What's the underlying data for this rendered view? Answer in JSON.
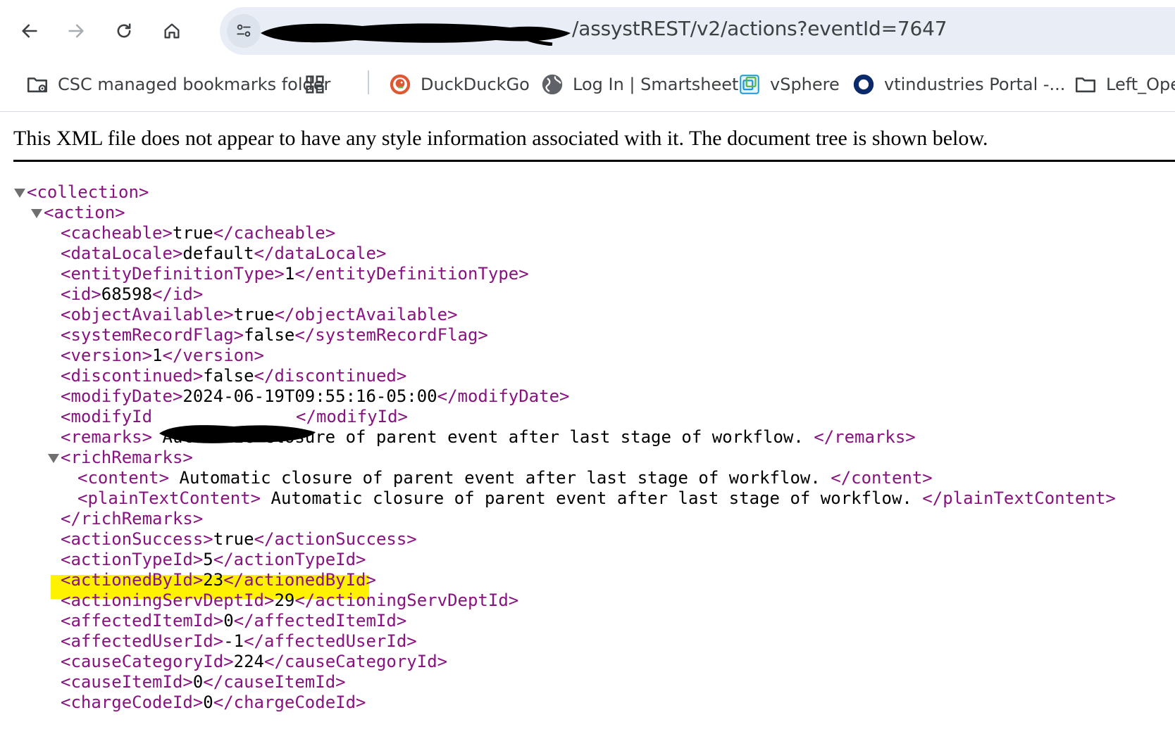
{
  "browser": {
    "url": "/assystREST/v2/actions?eventId=7647",
    "nav": [
      "back-icon",
      "forward-icon",
      "reload-icon",
      "home-icon"
    ]
  },
  "bookmarks": [
    {
      "label": "CSC managed bookmarks folder",
      "icon": "managed-folder-icon"
    },
    {
      "label": "DuckDuckGo",
      "icon": "duckduckgo-icon"
    },
    {
      "label": "Log In | Smartsheet",
      "icon": "globe-icon"
    },
    {
      "label": "vSphere",
      "icon": "vsphere-icon"
    },
    {
      "label": "vtindustries Portal -...",
      "icon": "portal-icon"
    },
    {
      "label": "Left_Ope",
      "icon": "folder-icon"
    }
  ],
  "xml": {
    "notice": "This XML file does not appear to have any style information associated with it. The document tree is shown below.",
    "lines": [
      {
        "open": "<collection>"
      },
      {
        "open": "<action>"
      },
      {
        "open": "<cacheable>",
        "text": "true",
        "close": "</cacheable>"
      },
      {
        "open": "<dataLocale>",
        "text": "default",
        "close": "</dataLocale>"
      },
      {
        "open": "<entityDefinitionType>",
        "text": "1",
        "close": "</entityDefinitionType>"
      },
      {
        "open": "<id>",
        "text": "68598",
        "close": "</id>"
      },
      {
        "open": "<objectAvailable>",
        "text": "true",
        "close": "</objectAvailable>"
      },
      {
        "open": "<systemRecordFlag>",
        "text": "false",
        "close": "</systemRecordFlag>"
      },
      {
        "open": "<version>",
        "text": "1",
        "close": "</version>"
      },
      {
        "open": "<discontinued>",
        "text": "false",
        "close": "</discontinued>"
      },
      {
        "open": "<modifyDate>",
        "text": "2024-06-19T09:55:16-05:00",
        "close": "</modifyDate>"
      },
      {
        "open": "<modifyId",
        "text": "",
        "close": "</modifyId>"
      },
      {
        "open": "<remarks>",
        "text": " Automatic closure of parent event after last stage of workflow. ",
        "close": "</remarks>"
      },
      {
        "open": "<richRemarks>"
      },
      {
        "open": "<content>",
        "text": " Automatic closure of parent event after last stage of workflow. ",
        "close": "</content>"
      },
      {
        "open": "<plainTextContent>",
        "text": " Automatic closure of parent event after last stage of workflow. ",
        "close": "</plainTextContent>"
      },
      {
        "open": "</richRemarks>"
      },
      {
        "open": "<actionSuccess>",
        "text": "true",
        "close": "</actionSuccess>"
      },
      {
        "open": "<actionTypeId>",
        "text": "5",
        "close": "</actionTypeId>"
      },
      {
        "open": "<actionedById>",
        "text": "23",
        "close": "</actionedById>"
      },
      {
        "open": "<actioningServDeptId>",
        "text": "29",
        "close": "</actioningServDeptId>"
      },
      {
        "open": "<affectedItemId>",
        "text": "0",
        "close": "</affectedItemId>"
      },
      {
        "open": "<affectedUserId>",
        "text": "-1",
        "close": "</affectedUserId>"
      },
      {
        "open": "<causeCategoryId>",
        "text": "224",
        "close": "</causeCategoryId>"
      },
      {
        "open": "<causeItemId>",
        "text": "0",
        "close": "</causeItemId>"
      },
      {
        "open": "<chargeCodeId>",
        "text": "0",
        "close": "</chargeCodeId>"
      }
    ]
  }
}
